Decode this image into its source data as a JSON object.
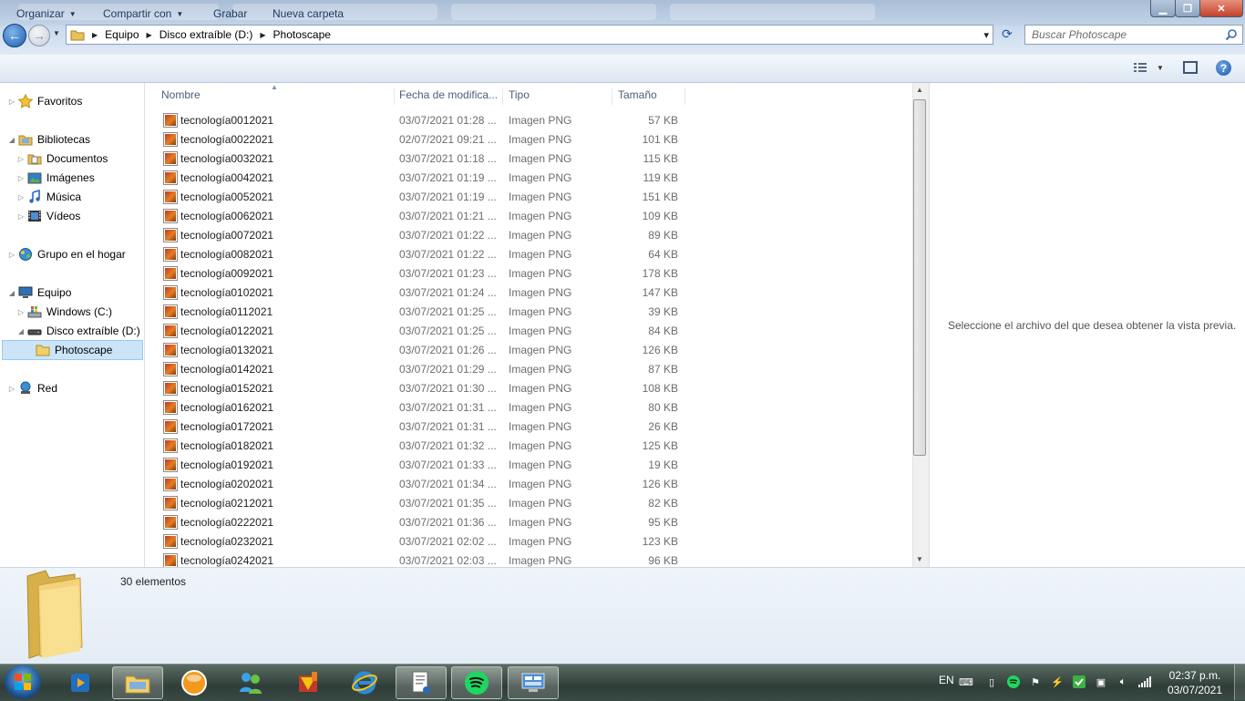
{
  "window": {
    "minimize_glyph": "▁",
    "maximize_glyph": "❐",
    "close_glyph": "✕"
  },
  "address_bar": {
    "breadcrumbs": [
      "Equipo",
      "Disco extraíble (D:)",
      "Photoscape"
    ],
    "dropdown_glyph": "▾",
    "refresh_glyph": "⟳"
  },
  "search": {
    "placeholder": "Buscar Photoscape"
  },
  "command_bar": {
    "organize": "Organizar",
    "share": "Compartir con",
    "burn": "Grabar",
    "new_folder": "Nueva carpeta",
    "help": "?"
  },
  "nav_pane": {
    "favorites": "Favoritos",
    "libraries": "Bibliotecas",
    "documents": "Documentos",
    "pictures": "Imágenes",
    "music": "Música",
    "videos": "Vídeos",
    "homegroup": "Grupo en el hogar",
    "computer": "Equipo",
    "drive_c": "Windows (C:)",
    "drive_d": "Disco extraíble (D:)",
    "folder": "Photoscape",
    "network": "Red"
  },
  "file_list": {
    "columns": [
      "Nombre",
      "Fecha de modifica...",
      "Tipo",
      "Tamaño"
    ],
    "files": [
      {
        "name": "tecnología0012021",
        "date": "03/07/2021 01:28 ...",
        "type": "Imagen PNG",
        "size": "57 KB"
      },
      {
        "name": "tecnología0022021",
        "date": "02/07/2021 09:21 ...",
        "type": "Imagen PNG",
        "size": "101 KB"
      },
      {
        "name": "tecnología0032021",
        "date": "03/07/2021 01:18 ...",
        "type": "Imagen PNG",
        "size": "115 KB"
      },
      {
        "name": "tecnología0042021",
        "date": "03/07/2021 01:19 ...",
        "type": "Imagen PNG",
        "size": "119 KB"
      },
      {
        "name": "tecnología0052021",
        "date": "03/07/2021 01:19 ...",
        "type": "Imagen PNG",
        "size": "151 KB"
      },
      {
        "name": "tecnología0062021",
        "date": "03/07/2021 01:21 ...",
        "type": "Imagen PNG",
        "size": "109 KB"
      },
      {
        "name": "tecnología0072021",
        "date": "03/07/2021 01:22 ...",
        "type": "Imagen PNG",
        "size": "89 KB"
      },
      {
        "name": "tecnología0082021",
        "date": "03/07/2021 01:22 ...",
        "type": "Imagen PNG",
        "size": "64 KB"
      },
      {
        "name": "tecnología0092021",
        "date": "03/07/2021 01:23 ...",
        "type": "Imagen PNG",
        "size": "178 KB"
      },
      {
        "name": "tecnología0102021",
        "date": "03/07/2021 01:24 ...",
        "type": "Imagen PNG",
        "size": "147 KB"
      },
      {
        "name": "tecnología0112021",
        "date": "03/07/2021 01:25 ...",
        "type": "Imagen PNG",
        "size": "39 KB"
      },
      {
        "name": "tecnología0122021",
        "date": "03/07/2021 01:25 ...",
        "type": "Imagen PNG",
        "size": "84 KB"
      },
      {
        "name": "tecnología0132021",
        "date": "03/07/2021 01:26 ...",
        "type": "Imagen PNG",
        "size": "126 KB"
      },
      {
        "name": "tecnología0142021",
        "date": "03/07/2021 01:29 ...",
        "type": "Imagen PNG",
        "size": "87 KB"
      },
      {
        "name": "tecnología0152021",
        "date": "03/07/2021 01:30 ...",
        "type": "Imagen PNG",
        "size": "108 KB"
      },
      {
        "name": "tecnología0162021",
        "date": "03/07/2021 01:31 ...",
        "type": "Imagen PNG",
        "size": "80 KB"
      },
      {
        "name": "tecnología0172021",
        "date": "03/07/2021 01:31 ...",
        "type": "Imagen PNG",
        "size": "26 KB"
      },
      {
        "name": "tecnología0182021",
        "date": "03/07/2021 01:32 ...",
        "type": "Imagen PNG",
        "size": "125 KB"
      },
      {
        "name": "tecnología0192021",
        "date": "03/07/2021 01:33 ...",
        "type": "Imagen PNG",
        "size": "19 KB"
      },
      {
        "name": "tecnología0202021",
        "date": "03/07/2021 01:34 ...",
        "type": "Imagen PNG",
        "size": "126 KB"
      },
      {
        "name": "tecnología0212021",
        "date": "03/07/2021 01:35 ...",
        "type": "Imagen PNG",
        "size": "82 KB"
      },
      {
        "name": "tecnología0222021",
        "date": "03/07/2021 01:36 ...",
        "type": "Imagen PNG",
        "size": "95 KB"
      },
      {
        "name": "tecnología0232021",
        "date": "03/07/2021 02:02 ...",
        "type": "Imagen PNG",
        "size": "123 KB"
      },
      {
        "name": "tecnología0242021",
        "date": "03/07/2021 02:03 ...",
        "type": "Imagen PNG",
        "size": "96 KB"
      }
    ]
  },
  "preview_pane": {
    "message": "Seleccione el archivo del que desea obtener la vista previa."
  },
  "details_pane": {
    "item_count": "30 elementos"
  },
  "taskbar": {
    "language": "EN",
    "time": "02:37 p.m.",
    "date": "03/07/2021"
  }
}
